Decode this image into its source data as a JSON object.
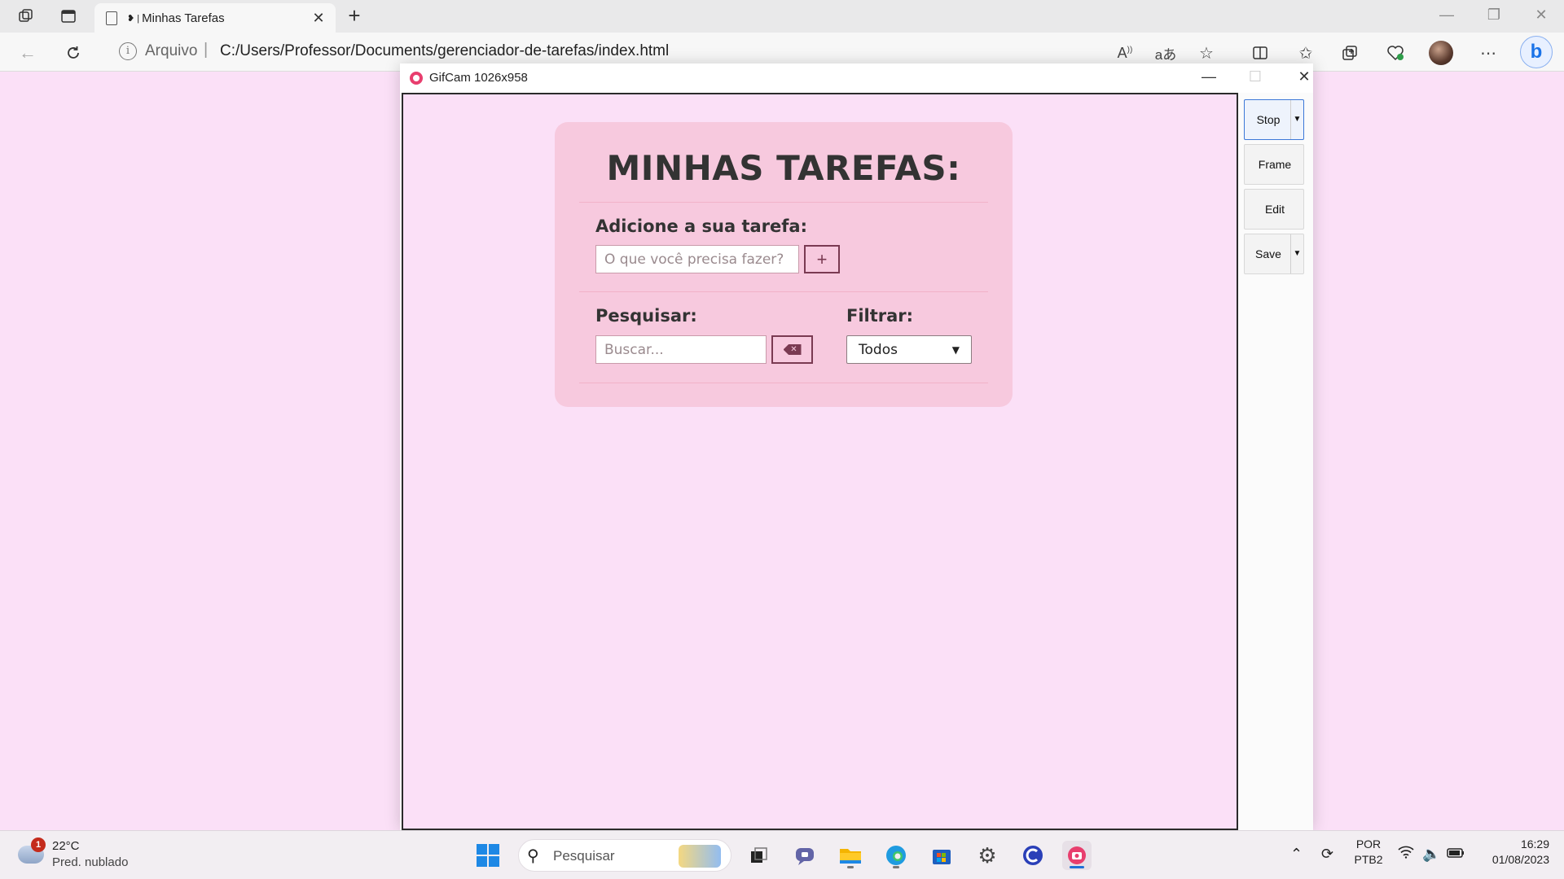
{
  "browser": {
    "tab": {
      "icon": "page-icon",
      "title": "Minhas Tarefas",
      "prefix": "❥ |"
    },
    "new_tab": "+",
    "address": {
      "scheme": "Arquivo",
      "url": "C:/Users/Professor/Documents/gerenciador-de-tarefas/index.html"
    }
  },
  "gifcam": {
    "title": "GifCam 1026x958",
    "buttons": {
      "stop": "Stop",
      "frame": "Frame",
      "edit": "Edit",
      "save": "Save"
    },
    "accent": "#3c78d8"
  },
  "app": {
    "title": "MINHAS TAREFAS:",
    "add": {
      "label": "Adicione a sua tarefa:",
      "placeholder": "O que você precisa fazer?",
      "button": "+"
    },
    "search": {
      "label": "Pesquisar:",
      "placeholder": "Buscar...",
      "clear_icon": "backspace-icon"
    },
    "filter": {
      "label": "Filtrar:",
      "selected": "Todos"
    },
    "colors": {
      "background": "#fbe0f7",
      "card": "#f7c9de",
      "text": "#333333",
      "button_border": "#7a3a52"
    }
  },
  "taskbar": {
    "weather": {
      "badge": "1",
      "temp": "22°C",
      "desc": "Pred. nublado"
    },
    "search": {
      "placeholder": "Pesquisar"
    },
    "language": {
      "line1": "POR",
      "line2": "PTB2"
    },
    "clock": {
      "time": "16:29",
      "date": "01/08/2023"
    }
  }
}
